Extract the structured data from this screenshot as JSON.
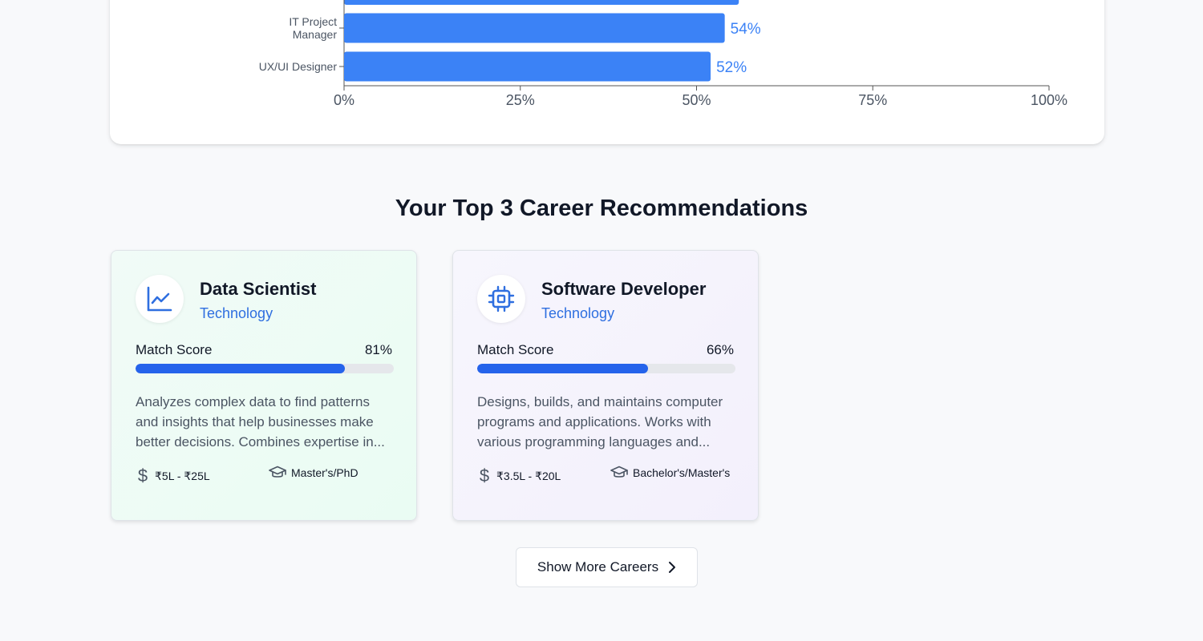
{
  "chart_data": {
    "type": "bar",
    "orientation": "horizontal",
    "categories": [
      "IT Project Manager",
      "UX/UI Designer"
    ],
    "category_lines": [
      [
        "IT Project",
        "Manager"
      ],
      [
        "UX/UI Designer"
      ]
    ],
    "values": [
      54,
      52
    ],
    "value_labels": [
      "54%",
      "52%"
    ],
    "xlim": [
      0,
      100
    ],
    "x_ticks": [
      0,
      25,
      50,
      75,
      100
    ],
    "x_tick_labels": [
      "0%",
      "25%",
      "50%",
      "75%",
      "100%"
    ],
    "bar_color": "#3b82f6",
    "value_label_color": "#3b82f6",
    "partially_visible_bar_above_value": 56
  },
  "section": {
    "title": "Your Top 3 Career Recommendations"
  },
  "careers": [
    {
      "title": "Data Scientist",
      "category": "Technology",
      "icon": "line-chart-icon",
      "match_label": "Match Score",
      "match_score": 81,
      "match_text": "81%",
      "description": "Analyzes complex data to find patterns and insights that help businesses make better decisions. Combines expertise in...",
      "salary": "₹5L - ₹25L",
      "education": "Master's/PhD",
      "card_color": "#eefbf5"
    },
    {
      "title": "Software Developer",
      "category": "Technology",
      "icon": "cpu-chip-icon",
      "match_label": "Match Score",
      "match_score": 66,
      "match_text": "66%",
      "description": "Designs, builds, and maintains computer programs and applications. Works with various programming languages and...",
      "salary": "₹3.5L - ₹20L",
      "education": "Bachelor's/Master's",
      "card_color": "#f5f3fd"
    }
  ],
  "show_more": {
    "label": "Show More Careers",
    "icon": "chevron-right-icon"
  },
  "colors": {
    "accent": "#2563eb",
    "category_text": "#2f6fe0",
    "background": "#f8f9fb"
  }
}
